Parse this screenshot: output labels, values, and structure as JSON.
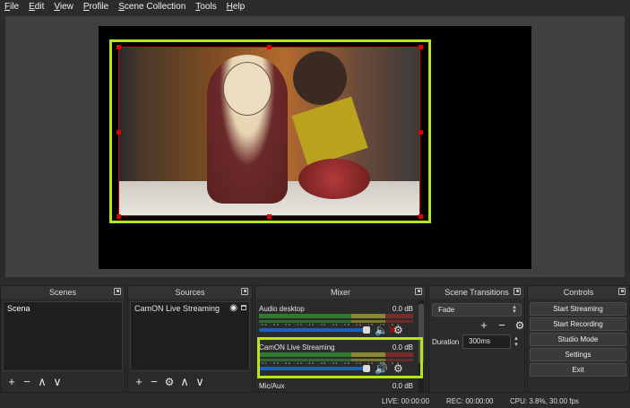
{
  "menu": [
    {
      "pre": "",
      "u": "F",
      "post": "ile"
    },
    {
      "pre": "",
      "u": "E",
      "post": "dit"
    },
    {
      "pre": "",
      "u": "V",
      "post": "iew"
    },
    {
      "pre": "",
      "u": "P",
      "post": "rofile"
    },
    {
      "pre": "",
      "u": "S",
      "post": "cene Collection"
    },
    {
      "pre": "",
      "u": "T",
      "post": "ools"
    },
    {
      "pre": "",
      "u": "H",
      "post": "elp"
    }
  ],
  "scenes": {
    "title": "Scenes",
    "items": [
      "Scena"
    ]
  },
  "sources": {
    "title": "Sources",
    "items": [
      {
        "label": "CamON Live Streaming",
        "visible_icon": "eye-icon",
        "lock_icon": "lock-icon"
      }
    ]
  },
  "mixer": {
    "title": "Mixer",
    "ticks": "-60 -55 -50 -45 -40 -35 -30 -25 -20 -15 -10 -5 0",
    "channels": [
      {
        "name": "Audio desktop",
        "db": "0.0 dB",
        "muted": true
      },
      {
        "name": "CamON Live Streaming",
        "db": "0.0 dB",
        "muted": false
      },
      {
        "name": "Mic/Aux",
        "db": "0.0 dB",
        "muted": false
      }
    ]
  },
  "transitions": {
    "title": "Scene Transitions",
    "selected": "Fade",
    "duration_label": "Duration",
    "duration_value": "300ms"
  },
  "controls": {
    "title": "Controls",
    "buttons": [
      "Start Streaming",
      "Start Recording",
      "Studio Mode",
      "Settings",
      "Exit"
    ]
  },
  "status": {
    "live": "LIVE: 00:00:00",
    "rec": "REC: 00:00:00",
    "cpu": "CPU: 3.8%, 30.00 fps"
  },
  "colors": {
    "highlight": "#b5e61d",
    "selection_handles": "#e00000",
    "fader": "#1b5fbf"
  }
}
